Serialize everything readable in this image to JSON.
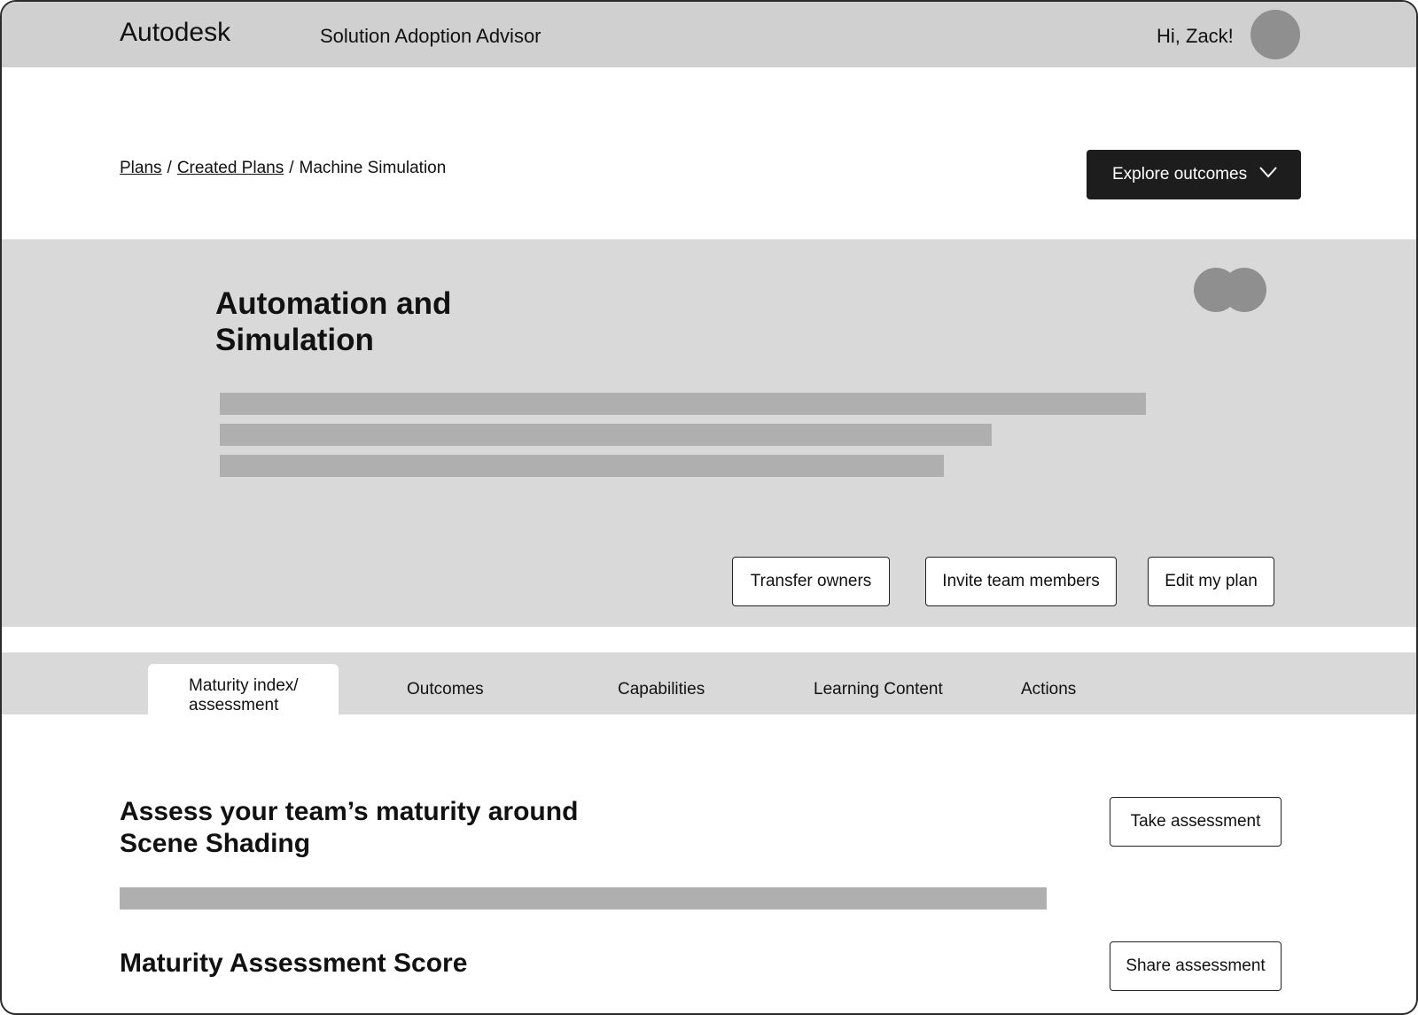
{
  "header": {
    "brand": "Autodesk",
    "app_title": "Solution Adoption Advisor",
    "greeting": "Hi, Zack!"
  },
  "breadcrumb": {
    "items": [
      "Plans",
      "Created Plans",
      "Machine Simulation"
    ],
    "separator": "/"
  },
  "explore": {
    "label": "Explore outcomes",
    "icon": "chevron-down-icon"
  },
  "hero": {
    "title": "Automation and Simulation",
    "buttons": {
      "transfer": "Transfer owners",
      "invite": "Invite team members",
      "edit": "Edit my plan"
    }
  },
  "tabs": [
    {
      "label": "Maturity index/ assessment",
      "active": true
    },
    {
      "label": "Outcomes",
      "active": false
    },
    {
      "label": "Capabilities",
      "active": false
    },
    {
      "label": "Learning Content",
      "active": false
    },
    {
      "label": "Actions",
      "active": false
    }
  ],
  "content": {
    "assess_heading": "Assess your team’s maturity around Scene Shading",
    "take_label": "Take assessment",
    "score_heading": "Maturity Assessment Score",
    "share_label": "Share assessment"
  },
  "colors": {
    "topbar": "#d0d0d0",
    "hero": "#d9d9d9",
    "placeholder": "#afafaf",
    "primary_button": "#1d1d1d",
    "avatar": "#8f8f8f"
  }
}
